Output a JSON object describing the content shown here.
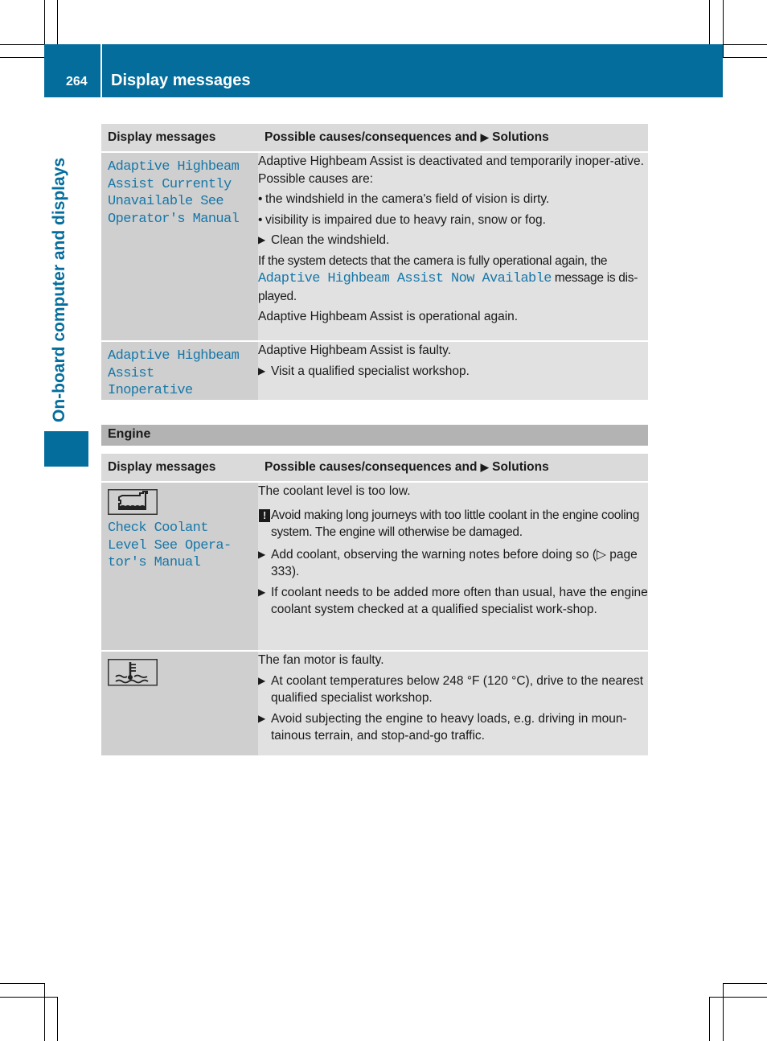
{
  "header": {
    "page_number": "264",
    "title": "Display messages"
  },
  "side_tab": {
    "label": "On-board computer and displays"
  },
  "table_header": {
    "col1": "Display messages",
    "col2_prefix": "Possible causes/consequences and",
    "col2_arrow": "▶",
    "col2_suffix": "Solutions"
  },
  "highbeam_rows": [
    {
      "message": "Adaptive Highbeam Assist Currently Unavailable See Operator's Manual",
      "intro": "Adaptive Highbeam Assist is deactivated and temporarily inoper-ative. Possible causes are:",
      "causes": [
        "the windshield in the camera's field of vision is dirty.",
        "visibility is impaired due to heavy rain, snow or fog."
      ],
      "solution": "Clean the windshield.",
      "note_before": "If the system detects that the camera is fully operational again, the",
      "note_message": "Adaptive Highbeam Assist Now Available",
      "note_after": "message is dis-played.",
      "note_final": "Adaptive Highbeam Assist is operational again."
    },
    {
      "message": "Adaptive Highbeam Assist Inoperative",
      "intro": "Adaptive Highbeam Assist is faulty.",
      "solution": "Visit a qualified specialist workshop."
    }
  ],
  "engine_section": {
    "title": "Engine",
    "rows": [
      {
        "icon": "coolant-reservoir-icon",
        "message": "Check Coolant Level See Opera-tor's Manual",
        "intro": "The coolant level is too low.",
        "warning": "Avoid making long journeys with too little coolant in the engine cooling system. The engine will otherwise be damaged.",
        "solutions": [
          "Add coolant, observing the warning notes before doing so (▷ page 333).",
          "If coolant needs to be added more often than usual, have the engine coolant system checked at a qualified specialist work-shop."
        ]
      },
      {
        "icon": "coolant-temperature-icon",
        "intro": "The fan motor is faulty.",
        "solutions": [
          "At coolant temperatures below 248 °F (120 °C), drive to the nearest qualified specialist workshop.",
          "Avoid subjecting the engine to heavy loads, e.g. driving in moun-tainous terrain, and stop-and-go traffic."
        ]
      }
    ]
  },
  "colors": {
    "brand_blue": "#046d9c",
    "message_blue": "#1677a8"
  }
}
